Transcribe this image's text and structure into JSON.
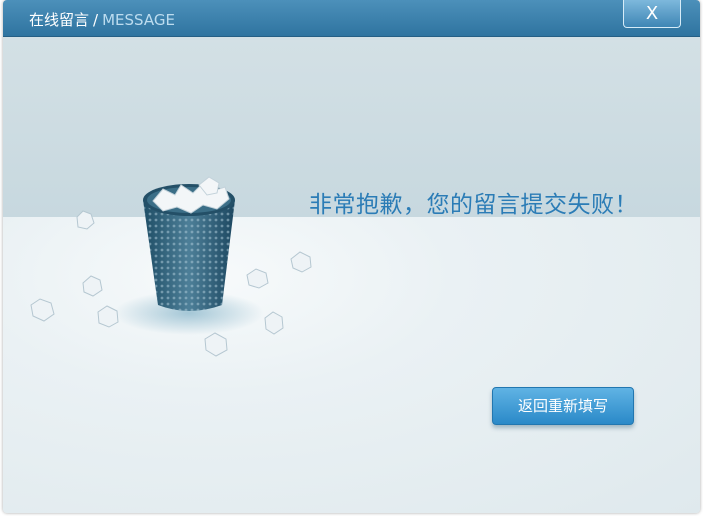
{
  "window": {
    "title_cn": "在线留言",
    "title_separator": "/",
    "title_en": "MESSAGE",
    "close_label": "X"
  },
  "main": {
    "message": "非常抱歉，您的留言提交失败！",
    "back_button_label": "返回重新填写"
  },
  "icons": {
    "illustration": "trash-bin-with-crumpled-paper-icon",
    "close": "close-icon"
  },
  "colors": {
    "titlebar": "#3b7fab",
    "message_text": "#2b7cb6",
    "button": "#3b97d3"
  }
}
